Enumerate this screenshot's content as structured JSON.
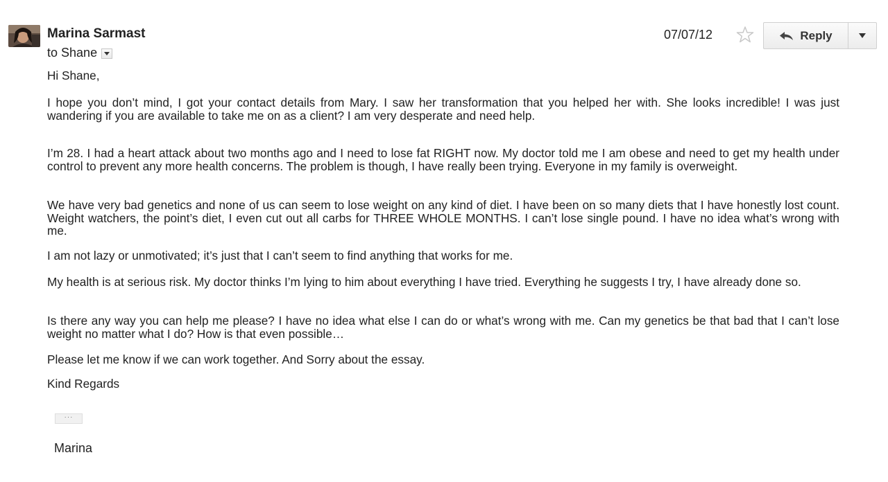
{
  "message": {
    "sender_name": "Marina Sarmast",
    "to_prefix": "to",
    "recipient": "Shane",
    "date": "07/07/12",
    "reply_label": "Reply",
    "greeting": "Hi Shane,",
    "paragraphs": [
      "I hope you don’t mind, I got your contact details from Mary. I saw her transformation that you helped her with. She looks incredible! I was just wandering if you are available to take me on as a client? I am very desperate and need help.",
      "I’m 28. I had a heart attack about two months ago and I need to lose fat RIGHT now. My doctor told me I am obese and need to get my health under control to prevent any more health concerns. The problem is though, I have really been trying. Everyone in my family is overweight.",
      "We have very bad genetics and none of us can seem to lose weight on any kind of diet. I have been on so many diets that I have honestly lost count. Weight watchers, the point’s diet, I even cut out all carbs for THREE WHOLE MONTHS. I can’t lose single pound.  I have no idea what’s wrong with me.",
      "I am not lazy or unmotivated; it’s just that I can’t seem to find anything that works for me.",
      "My health is at serious risk. My doctor thinks I’m lying to him about everything I have tried. Everything he suggests I try, I have already done so.",
      "Is there any way you can help me please? I have no idea what else I can do or what’s wrong with me. Can my genetics be that bad that I can’t lose weight no matter what I do? How is that even possible…",
      "Please let me know if we can work together. And Sorry about the essay."
    ],
    "closing": "Kind Regards",
    "trimmed_content_label": "···",
    "signature": "Marina"
  },
  "icons": {
    "avatar": "sender-avatar",
    "star": "star-outline-icon",
    "reply": "reply-arrow-icon",
    "more": "chevron-down-icon",
    "recipient_details": "chevron-down-icon"
  },
  "colors": {
    "text": "#222222",
    "button_border": "#d0d0d0",
    "star_outline": "#c8c8c8"
  }
}
